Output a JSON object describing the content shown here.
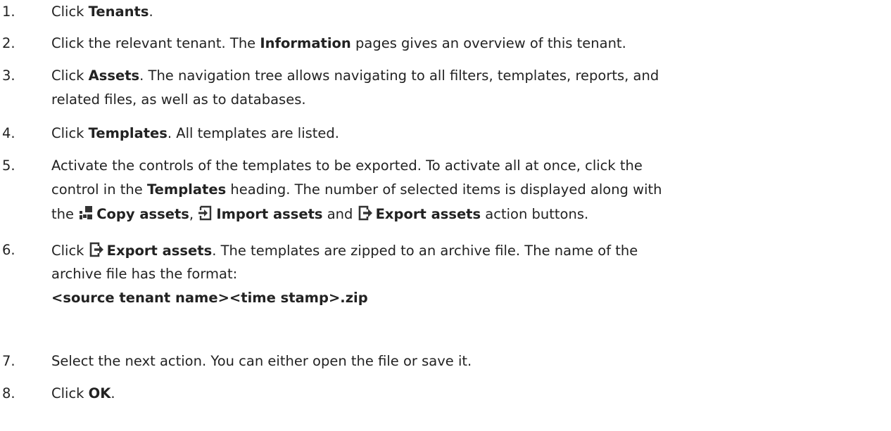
{
  "steps": [
    {
      "number": "1.",
      "lines": [
        [
          {
            "text": "Click "
          },
          {
            "text": "Tenants",
            "bold": true
          },
          {
            "text": "."
          }
        ]
      ]
    },
    {
      "number": "2.",
      "lines": [
        [
          {
            "text": "Click the relevant tenant. The "
          },
          {
            "text": "Information",
            "bold": true
          },
          {
            "text": " pages gives an overview of this tenant."
          }
        ]
      ]
    },
    {
      "number": "3.",
      "lines": [
        [
          {
            "text": "Click "
          },
          {
            "text": "Assets",
            "bold": true
          },
          {
            "text": ". The navigation tree allows navigating to all filters, templates, reports, and"
          }
        ],
        [
          {
            "text": "related files, as well as to databases."
          }
        ]
      ]
    },
    {
      "number": "4.",
      "lines": [
        [
          {
            "text": "Click "
          },
          {
            "text": "Templates",
            "bold": true
          },
          {
            "text": ". All templates are listed."
          }
        ]
      ]
    },
    {
      "number": "5.",
      "lines": [
        [
          {
            "text": "Activate the controls of the templates to be exported. To activate all at once, click the"
          }
        ],
        [
          {
            "text": "control in the "
          },
          {
            "text": "Templates",
            "bold": true
          },
          {
            "text": " heading. The number of selected items is displayed along with"
          }
        ],
        [
          {
            "text": "the "
          },
          {
            "icon": "copy-assets-icon"
          },
          {
            "text": "Copy assets",
            "bold": true
          },
          {
            "text": ", "
          },
          {
            "icon": "import-assets-icon"
          },
          {
            "text": "Import assets",
            "bold": true
          },
          {
            "text": " and "
          },
          {
            "icon": "export-assets-icon"
          },
          {
            "text": "Export assets",
            "bold": true
          },
          {
            "text": " action buttons."
          }
        ]
      ]
    },
    {
      "number": "6.",
      "lines": [
        [
          {
            "text": "Click "
          },
          {
            "icon": "export-assets-icon"
          },
          {
            "text": "Export assets",
            "bold": true
          },
          {
            "text": ". The templates are zipped to an archive file. The name of the"
          }
        ],
        [
          {
            "text": "archive file has the format:"
          }
        ],
        [
          {
            "text": "<source tenant name><time stamp>.zip",
            "bold": true
          }
        ]
      ]
    },
    {
      "number": "7.",
      "lines": [
        [
          {
            "text": "Select the next action. You can either open the file or save it."
          }
        ]
      ]
    },
    {
      "number": "8.",
      "lines": [
        [
          {
            "text": "Click "
          },
          {
            "text": "OK",
            "bold": true
          },
          {
            "text": "."
          }
        ]
      ]
    }
  ],
  "colors": {
    "text": "#222222",
    "icon": "#333333",
    "background": "#ffffff"
  }
}
